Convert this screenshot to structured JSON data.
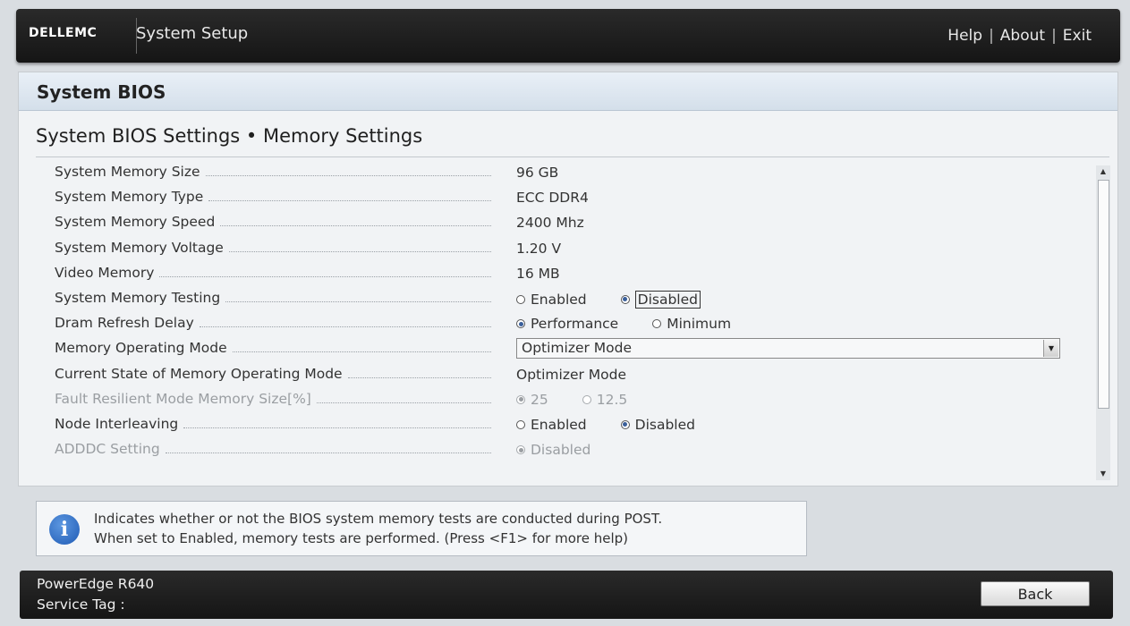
{
  "header": {
    "brand": "DELLEMC",
    "title": "System Setup",
    "links": [
      "Help",
      "About",
      "Exit"
    ]
  },
  "panel": {
    "title": "System BIOS",
    "page_title": "System BIOS Settings • Memory Settings"
  },
  "settings": [
    {
      "label": "System Memory Size",
      "value": "96 GB"
    },
    {
      "label": "System Memory Type",
      "value": "ECC DDR4"
    },
    {
      "label": "System Memory Speed",
      "value": "2400 Mhz"
    },
    {
      "label": "System Memory Voltage",
      "value": "1.20 V"
    },
    {
      "label": "Video Memory",
      "value": "16 MB"
    },
    {
      "label": "System Memory Testing",
      "options": [
        "Enabled",
        "Disabled"
      ],
      "selected": "Disabled"
    },
    {
      "label": "Dram Refresh Delay",
      "options": [
        "Performance",
        "Minimum"
      ],
      "selected": "Performance"
    },
    {
      "label": "Memory Operating Mode",
      "dropdown": "Optimizer Mode"
    },
    {
      "label": "Current State of Memory Operating Mode",
      "value": "Optimizer Mode"
    },
    {
      "label": "Fault Resilient Mode Memory Size[%]",
      "options": [
        "25",
        "12.5"
      ],
      "selected": "25",
      "disabled": true
    },
    {
      "label": "Node Interleaving",
      "options": [
        "Enabled",
        "Disabled"
      ],
      "selected": "Disabled"
    },
    {
      "label": "ADDDC Setting",
      "options": [
        "Disabled"
      ],
      "selected": "Disabled",
      "disabled": true
    }
  ],
  "help": {
    "line1": "Indicates whether or not the BIOS system memory tests are conducted during POST.",
    "line2": "When set to Enabled, memory tests are performed. (Press <F1> for more help)",
    "icon": "info-icon"
  },
  "footer": {
    "model": "PowerEdge R640",
    "service_tag_label": "Service Tag :",
    "back_label": "Back"
  },
  "colors": {
    "bar": "#1c1c1c",
    "radio_selected": "#3a5f9a",
    "info_icon": "#1f5bb5"
  }
}
